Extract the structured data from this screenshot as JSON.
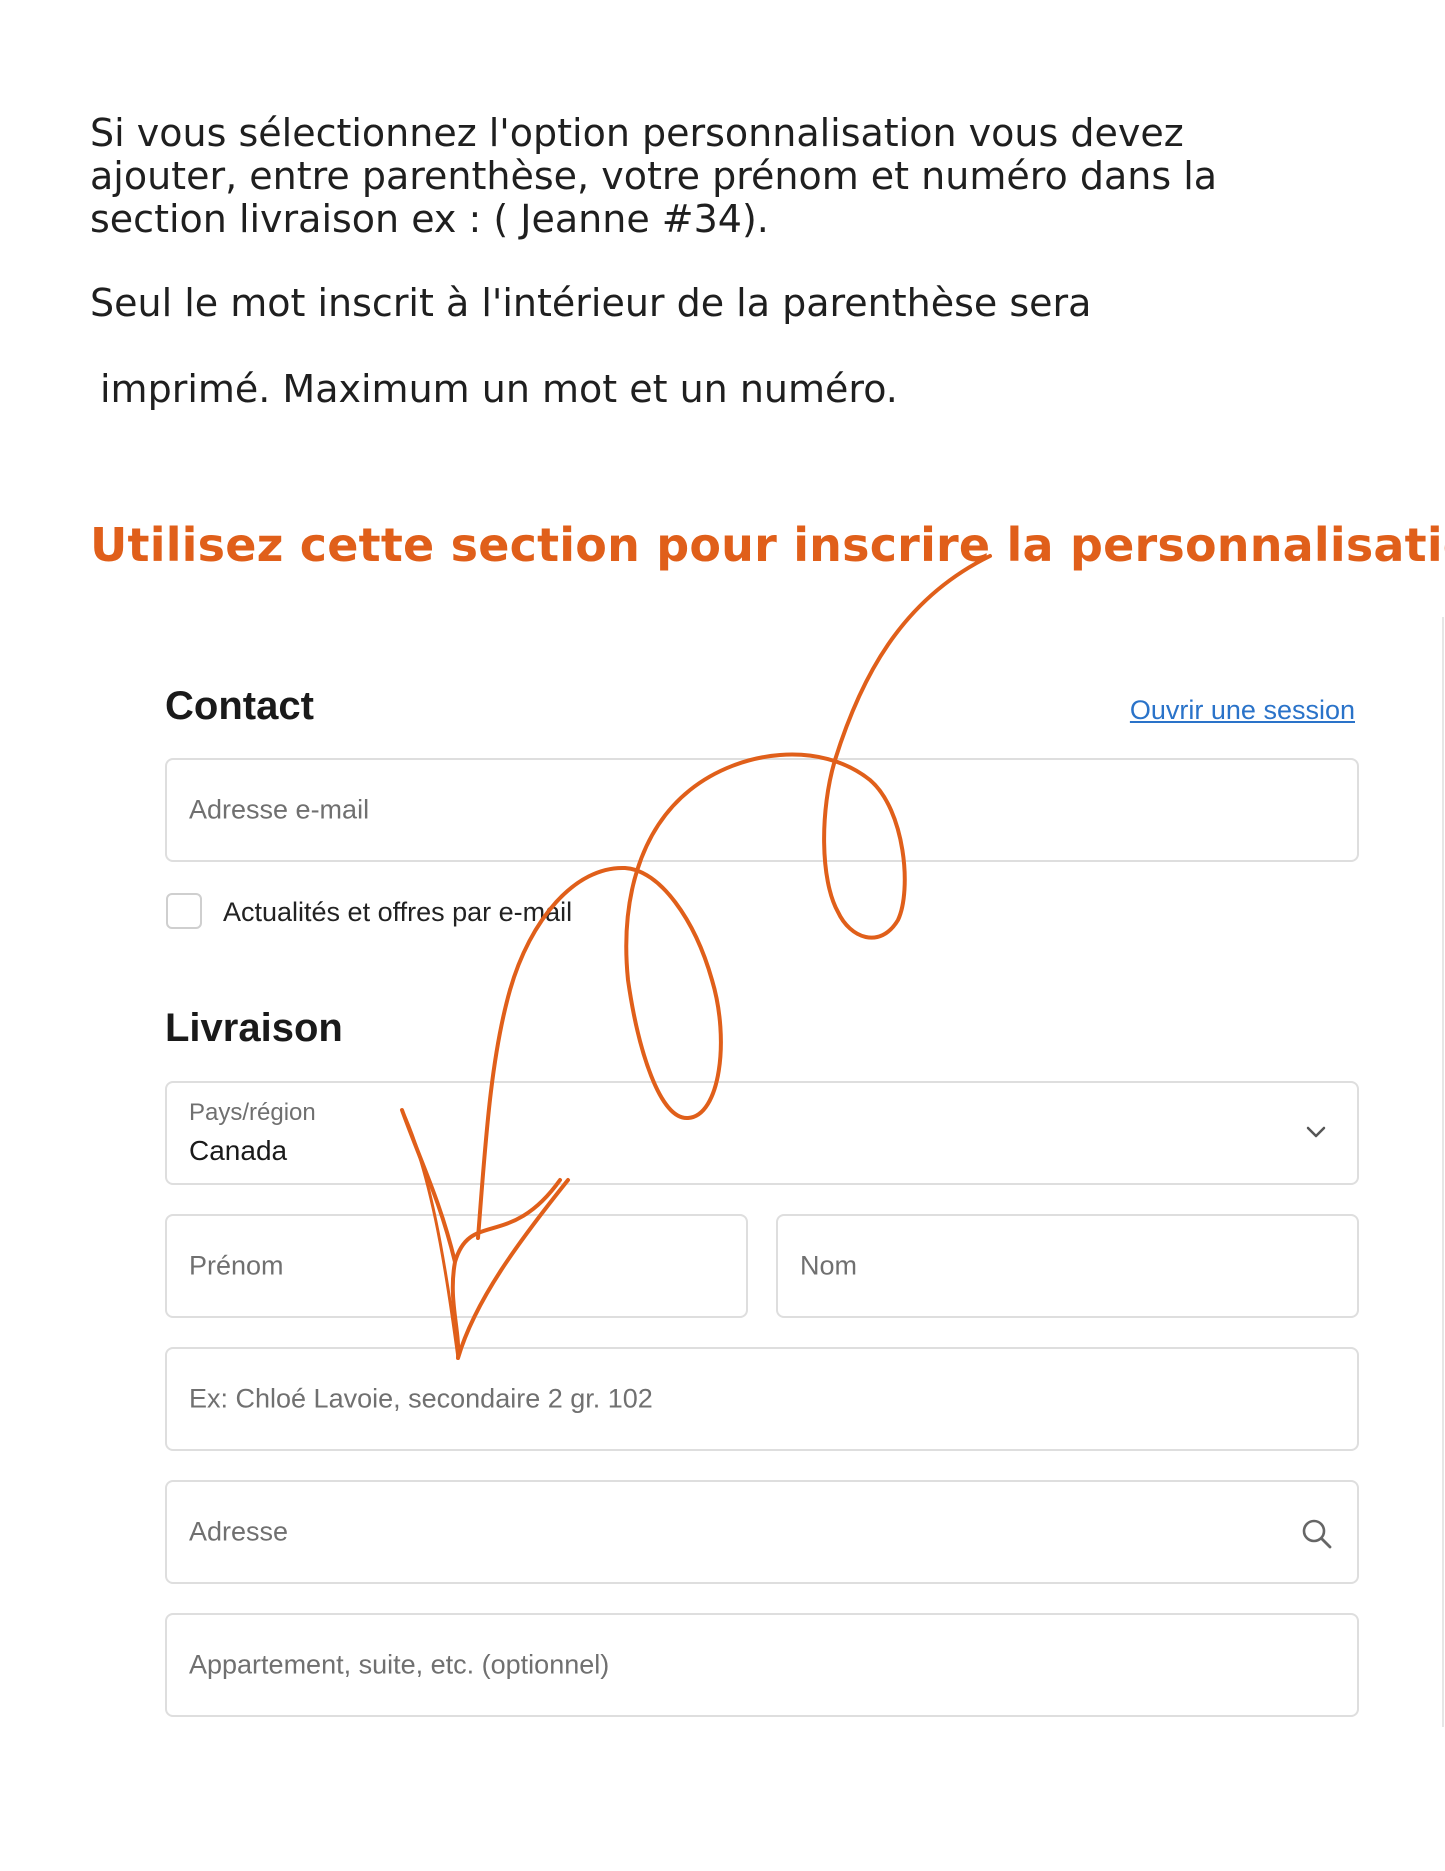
{
  "intro": {
    "line1": "Si vous sélectionnez l'option personnalisation vous devez ajouter, entre parenthèse, votre prénom et numéro dans la section livraison ex : ( Jeanne #34).",
    "line2": "Seul le mot inscrit à l'intérieur de la parenthèse sera",
    "line3": "imprimé. Maximum un mot et un numéro."
  },
  "headline": "Utilisez cette section pour inscrire la personnalisation",
  "contact": {
    "title": "Contact",
    "login_link": "Ouvrir une session",
    "email_placeholder": "Adresse e-mail",
    "newsletter_label": "Actualités et offres par e-mail"
  },
  "shipping": {
    "title": "Livraison",
    "country_label": "Pays/région",
    "country_value": "Canada",
    "first_name_placeholder": "Prénom",
    "last_name_placeholder": "Nom",
    "company_placeholder": "Ex: Chloé Lavoie, secondaire 2 gr. 102",
    "address_placeholder": "Adresse",
    "apartment_placeholder": "Appartement, suite, etc. (optionnel)"
  },
  "colors": {
    "accent": "#e05f1a",
    "link": "#2a73c9",
    "border": "#dedede"
  },
  "icons": [
    "chevron-down-icon",
    "search-icon",
    "hand-drawn-arrow"
  ]
}
